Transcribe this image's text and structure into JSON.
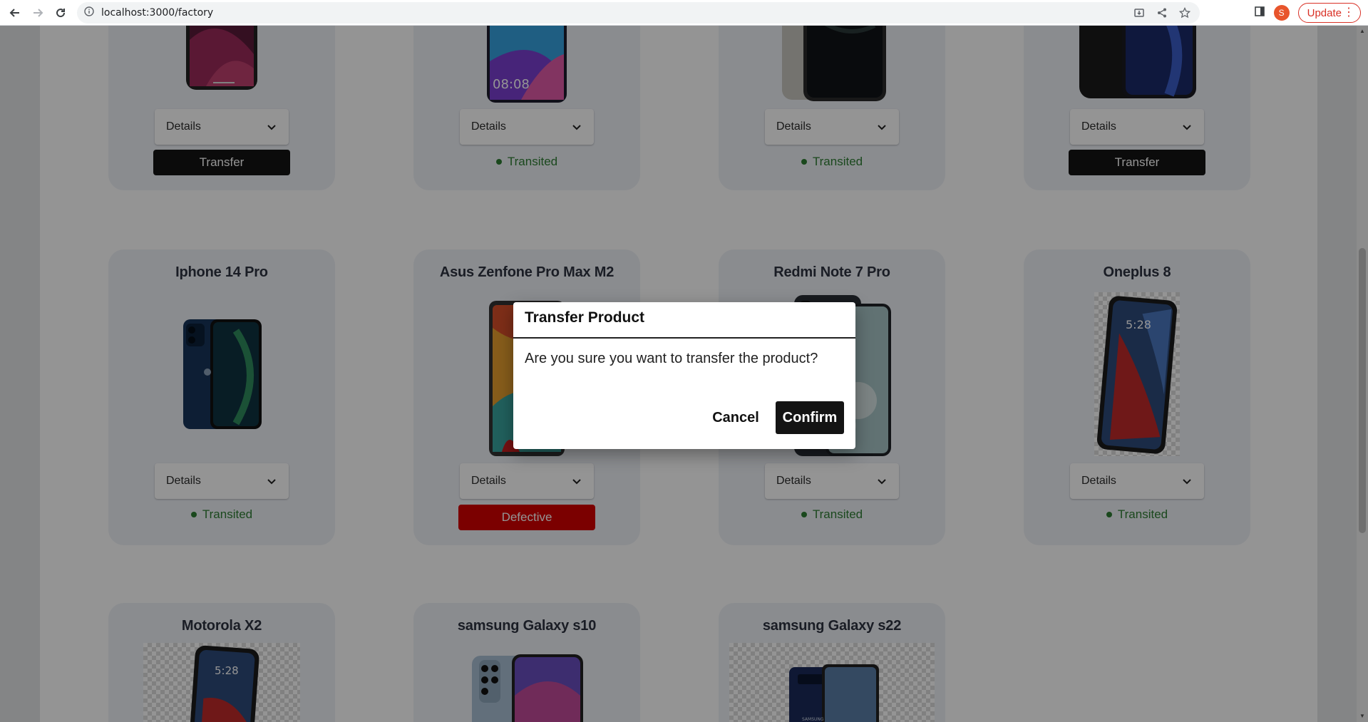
{
  "browser": {
    "url": "localhost:3000/factory",
    "profile_initial": "S",
    "update_label": "Update",
    "update_menu": "⋮"
  },
  "cards_row1": [
    {
      "details": "Details",
      "action": "Transfer",
      "action_type": "button"
    },
    {
      "details": "Details",
      "action": "Transited",
      "action_type": "status"
    },
    {
      "details": "Details",
      "action": "Transited",
      "action_type": "status"
    },
    {
      "details": "Details",
      "action": "Transfer",
      "action_type": "button"
    }
  ],
  "cards_row2": [
    {
      "title": "Iphone 14 Pro",
      "details": "Details",
      "action": "Transited",
      "action_type": "status"
    },
    {
      "title": "Asus Zenfone Pro Max M2",
      "details": "Details",
      "action": "Defective",
      "action_type": "defective"
    },
    {
      "title": "Redmi Note 7 Pro",
      "details": "Details",
      "action": "Transited",
      "action_type": "status"
    },
    {
      "title": "Oneplus 8",
      "details": "Details",
      "action": "Transited",
      "action_type": "status"
    }
  ],
  "cards_row3": [
    {
      "title": "Motorola X2"
    },
    {
      "title": "samsung Galaxy s10"
    },
    {
      "title": "samsung Galaxy s22"
    }
  ],
  "phone_screens": {
    "huawei_time": "08:08",
    "oneplus_time": "5:28",
    "motorola_time": "5:28",
    "samsung_brand": "SAMSUNG"
  },
  "modal": {
    "title": "Transfer Product",
    "body": "Are you sure you want to transfer the product?",
    "cancel": "Cancel",
    "confirm": "Confirm"
  },
  "colors": {
    "transited": "#2e7d32",
    "defective": "#d40000",
    "dark_button": "#141414"
  }
}
